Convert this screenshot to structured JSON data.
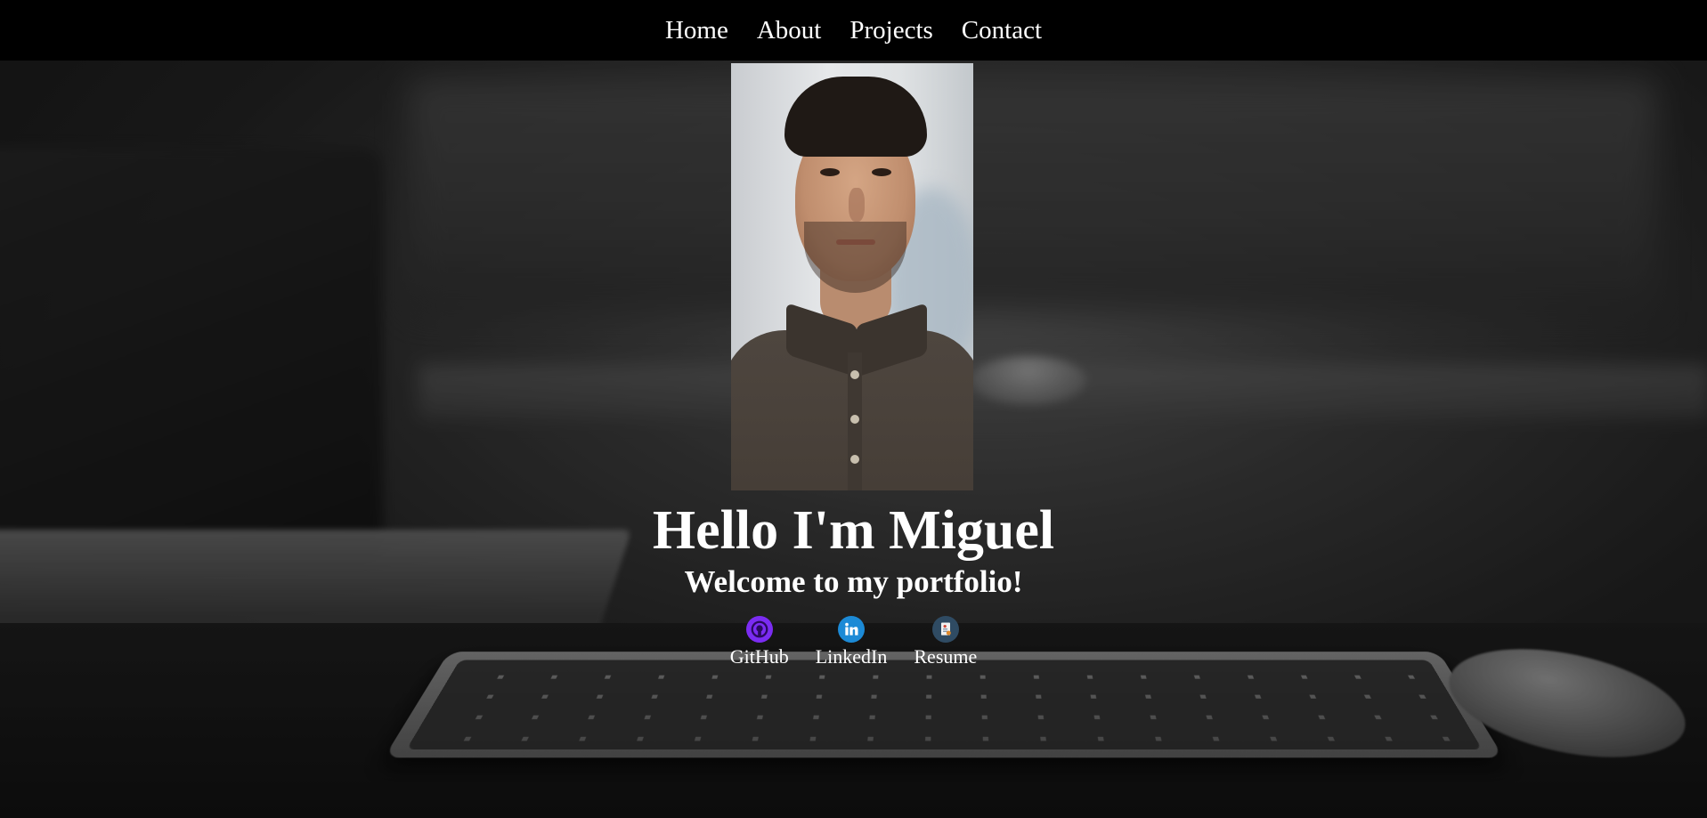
{
  "nav": {
    "items": [
      {
        "label": "Home"
      },
      {
        "label": "About"
      },
      {
        "label": "Projects"
      },
      {
        "label": "Contact"
      }
    ]
  },
  "hero": {
    "title": "Hello I'm Miguel",
    "subtitle": "Welcome to my portfolio!"
  },
  "links": [
    {
      "label": "GitHub",
      "icon": "github-icon",
      "color": "#7b2cf2"
    },
    {
      "label": "LinkedIn",
      "icon": "linkedin-icon",
      "color": "#1c8ad6"
    },
    {
      "label": "Resume",
      "icon": "resume-icon",
      "color": "#2f4b63"
    }
  ]
}
